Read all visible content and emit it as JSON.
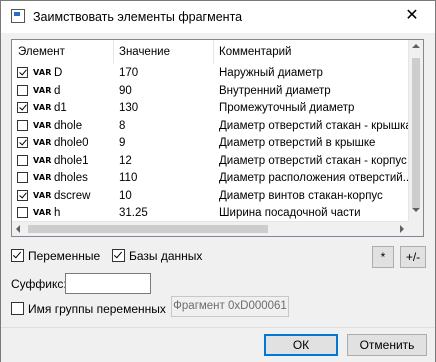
{
  "window": {
    "title": "Заимствовать элементы фрагмента",
    "close_glyph": "✕"
  },
  "table": {
    "headers": {
      "element": "Элемент",
      "value": "Значение",
      "comment": "Комментарий"
    },
    "var_badge": "VAR",
    "rows": [
      {
        "checked": true,
        "name": "D",
        "value": "170",
        "comment": "Наружный диаметр"
      },
      {
        "checked": false,
        "name": "d",
        "value": "90",
        "comment": "Внутренний диаметр"
      },
      {
        "checked": true,
        "name": "d1",
        "value": "130",
        "comment": "Промежуточный диаметр"
      },
      {
        "checked": false,
        "name": "dhole",
        "value": "8",
        "comment": "Диаметр отверстий стакан - крышка"
      },
      {
        "checked": true,
        "name": "dhole0",
        "value": "9",
        "comment": "Диаметр отверстий в крышке"
      },
      {
        "checked": false,
        "name": "dhole1",
        "value": "12",
        "comment": "Диаметр отверстий стакан - корпус"
      },
      {
        "checked": false,
        "name": "dholes",
        "value": "110",
        "comment": "Диаметр расположения отверстий..."
      },
      {
        "checked": true,
        "name": "dscrew",
        "value": "10",
        "comment": "Диаметр винтов стакан-корпус"
      },
      {
        "checked": false,
        "name": "h",
        "value": "31.25",
        "comment": "Ширина посадочной части"
      }
    ]
  },
  "options": {
    "variables": {
      "label": "Переменные",
      "checked": true
    },
    "databases": {
      "label": "Базы данных",
      "checked": true
    },
    "star_button": "*",
    "plusminus_button": "+/-",
    "suffix_label": "Суффикс:",
    "suffix_value": "",
    "group_name": {
      "label": "Имя группы переменных",
      "checked": false
    },
    "fragment_button": "Фрагмент 0xD000061"
  },
  "footer": {
    "ok": "ОК",
    "cancel": "Отменить"
  },
  "colors": {
    "accent": "#0078d7",
    "panel_border": "#828790"
  }
}
